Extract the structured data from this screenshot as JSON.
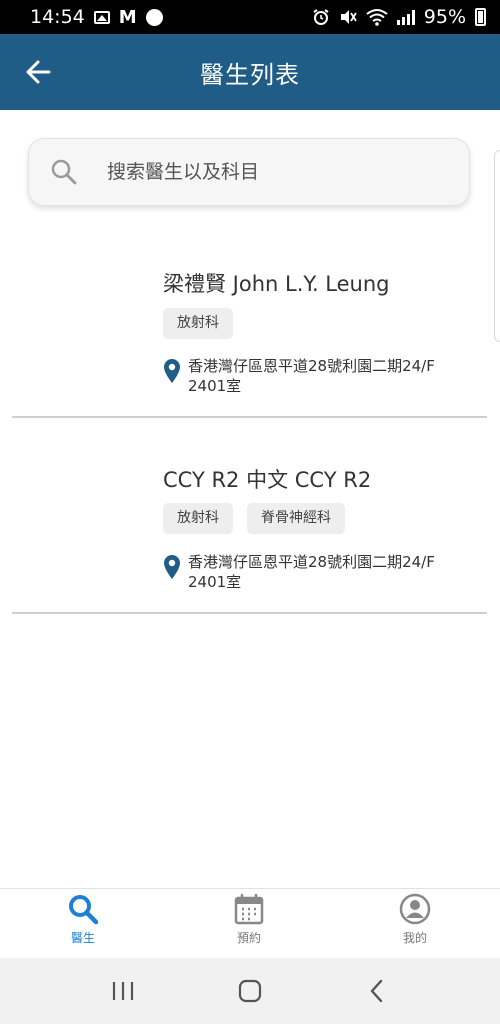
{
  "status_bar": {
    "time": "14:54",
    "battery": "95%",
    "icons": [
      "image-icon",
      "gmail-icon",
      "dot-icon",
      "alarm-icon",
      "mute-icon",
      "wifi-icon",
      "signal-icon",
      "battery-icon"
    ]
  },
  "app_bar": {
    "title": "醫生列表",
    "back_icon": "arrow-left-icon"
  },
  "search": {
    "placeholder": "搜索醫生以及科目"
  },
  "doctors": [
    {
      "name": "梁禮賢 John L.Y. Leung",
      "tags": [
        "放射科"
      ],
      "address": "香港灣仔區恩平道28號利園二期24/F 2401室"
    },
    {
      "name": "CCY R2 中文 CCY R2",
      "tags": [
        "放射科",
        "脊骨神經科"
      ],
      "address": "香港灣仔區恩平道28號利園二期24/F 2401室"
    }
  ],
  "bottom_nav": {
    "items": [
      {
        "label": "醫生",
        "icon": "search-icon",
        "active": true
      },
      {
        "label": "預約",
        "icon": "calendar-icon",
        "active": false
      },
      {
        "label": "我的",
        "icon": "profile-icon",
        "active": false
      }
    ]
  },
  "colors": {
    "primary": "#1f5d87",
    "active_nav": "#1d7fd6",
    "tag_bg": "#eeeeee"
  }
}
